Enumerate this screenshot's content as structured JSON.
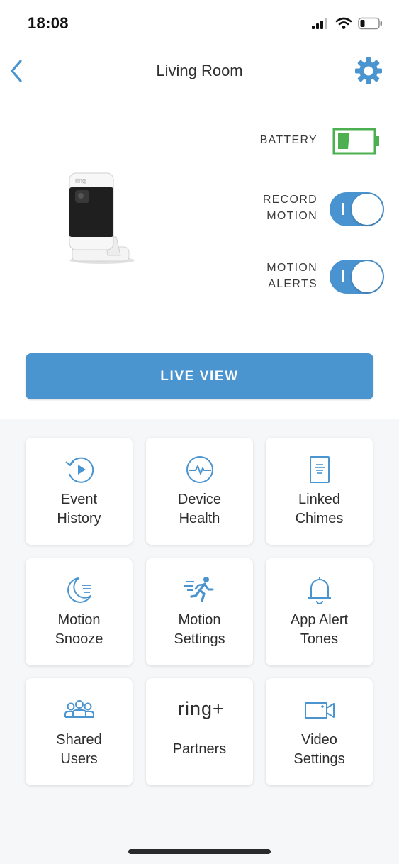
{
  "status_bar": {
    "time": "18:08"
  },
  "header": {
    "title": "Living Room",
    "back_icon": "chevron-left-icon",
    "settings_icon": "gear-icon"
  },
  "device": {
    "battery_label": "BATTERY",
    "battery_level": 0.3,
    "record_motion": {
      "line1": "RECORD",
      "line2": "MOTION",
      "on": true
    },
    "motion_alerts": {
      "line1": "MOTION",
      "line2": "ALERTS",
      "on": true
    }
  },
  "live_view_label": "LIVE VIEW",
  "colors": {
    "accent": "#4a94d0",
    "battery_green": "#4caf50",
    "background": "#f5f7f9"
  },
  "tiles": [
    {
      "icon": "event-history-icon",
      "line1": "Event",
      "line2": "History"
    },
    {
      "icon": "device-health-icon",
      "line1": "Device",
      "line2": "Health"
    },
    {
      "icon": "linked-chimes-icon",
      "line1": "Linked",
      "line2": "Chimes"
    },
    {
      "icon": "motion-snooze-icon",
      "line1": "Motion",
      "line2": "Snooze"
    },
    {
      "icon": "motion-settings-icon",
      "line1": "Motion",
      "line2": "Settings"
    },
    {
      "icon": "bell-icon",
      "line1": "App Alert",
      "line2": "Tones"
    },
    {
      "icon": "shared-users-icon",
      "line1": "Shared",
      "line2": "Users"
    },
    {
      "icon": "ring-plus-logo",
      "line1": "Partners",
      "logo_text": "ring+"
    },
    {
      "icon": "video-camera-icon",
      "line1": "Video",
      "line2": "Settings"
    }
  ]
}
